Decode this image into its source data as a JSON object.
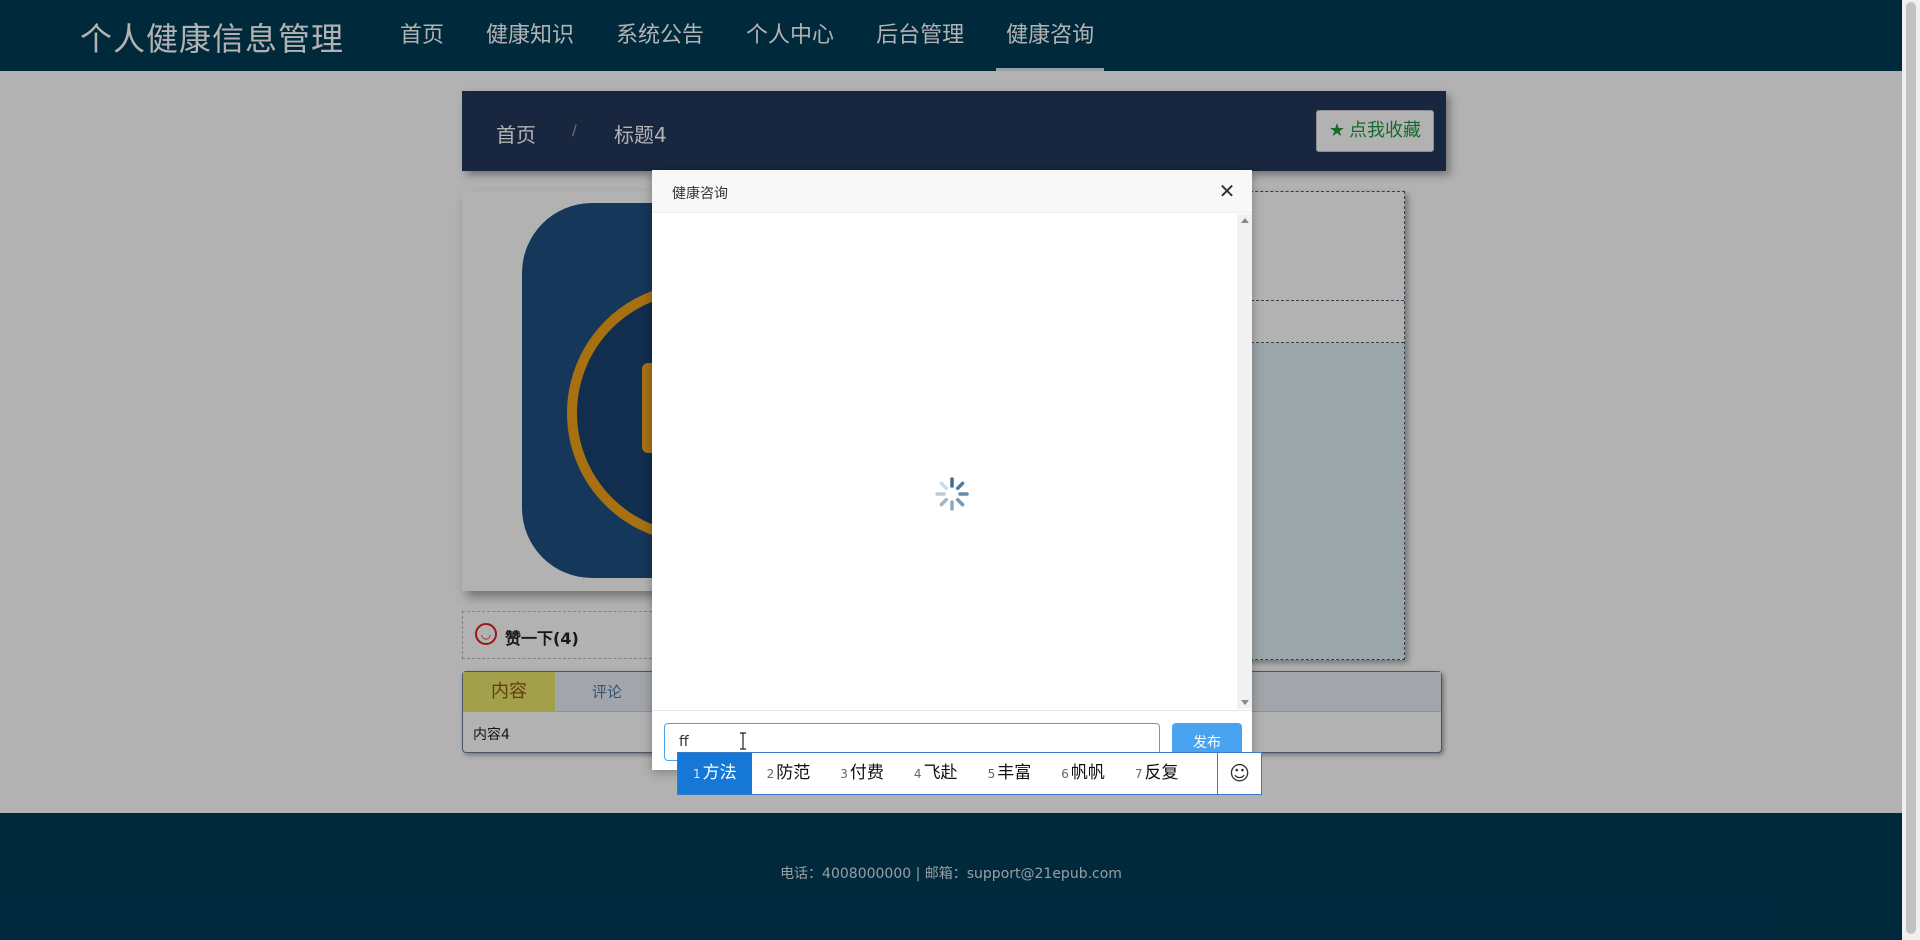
{
  "header": {
    "site_title": "个人健康信息管理",
    "nav": [
      "首页",
      "健康知识",
      "系统公告",
      "个人中心",
      "后台管理",
      "健康咨询"
    ]
  },
  "breadcrumb": {
    "home": "首页",
    "separator": "/",
    "current": "标题4"
  },
  "favorite_button": {
    "label": "点我收藏",
    "icon": "star-icon"
  },
  "like": {
    "label": "赞一下(4)",
    "icon": "smiley-icon"
  },
  "tabs": {
    "content_label": "内容",
    "comment_label": "评论",
    "body_text": "内容4"
  },
  "footer": {
    "text": "电话：4008000000 | 邮箱：support@21epub.com"
  },
  "modal": {
    "title": "健康咨询",
    "close_icon": "close-icon",
    "loading_icon": "spinner-icon",
    "input_value": "ff",
    "publish_label": "发布"
  },
  "ime": {
    "candidates": [
      {
        "num": "1",
        "text": "方法"
      },
      {
        "num": "2",
        "text": "防范"
      },
      {
        "num": "3",
        "text": "付费"
      },
      {
        "num": "4",
        "text": "飞赴"
      },
      {
        "num": "5",
        "text": "丰富"
      },
      {
        "num": "6",
        "text": "帆帆"
      },
      {
        "num": "7",
        "text": "反复"
      }
    ],
    "emoji_icon": "emoji-icon"
  },
  "colors": {
    "header_bg": "#003b57",
    "breadcrumb_bg": "#23395b",
    "accent_blue": "#4aa3f0",
    "ime_selected": "#1678d6",
    "favorite_green": "#1f9a43"
  }
}
